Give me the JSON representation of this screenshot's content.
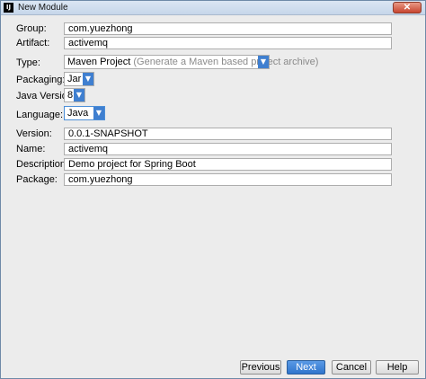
{
  "window": {
    "title": "New Module",
    "app_icon_text": "IJ",
    "close_label": "✕"
  },
  "form": {
    "group": {
      "label": "Group:",
      "value": "com.yuezhong"
    },
    "artifact": {
      "label": "Artifact:",
      "value": "activemq"
    },
    "type": {
      "label": "Type:",
      "value": "Maven Project",
      "hint": "(Generate a Maven based project archive)"
    },
    "packaging": {
      "label": "Packaging:",
      "value": "Jar"
    },
    "java_version": {
      "label": "Java Version:",
      "value": "8"
    },
    "language": {
      "label": "Language:",
      "value": "Java"
    },
    "version": {
      "label": "Version:",
      "value": "0.0.1-SNAPSHOT"
    },
    "name": {
      "label": "Name:",
      "value": "activemq"
    },
    "description": {
      "label": "Description:",
      "value": "Demo project for Spring Boot"
    },
    "package": {
      "label": "Package:",
      "value": "com.yuezhong"
    }
  },
  "buttons": {
    "previous": "Previous",
    "next": "Next",
    "cancel": "Cancel",
    "help": "Help"
  },
  "colors": {
    "accent": "#3f7fd0",
    "primary_button": "#2f74cc",
    "dialog_bg": "#ececec"
  },
  "icons": {
    "dropdown": "chevron-down-icon",
    "app": "intellij-icon",
    "close": "close-icon"
  }
}
